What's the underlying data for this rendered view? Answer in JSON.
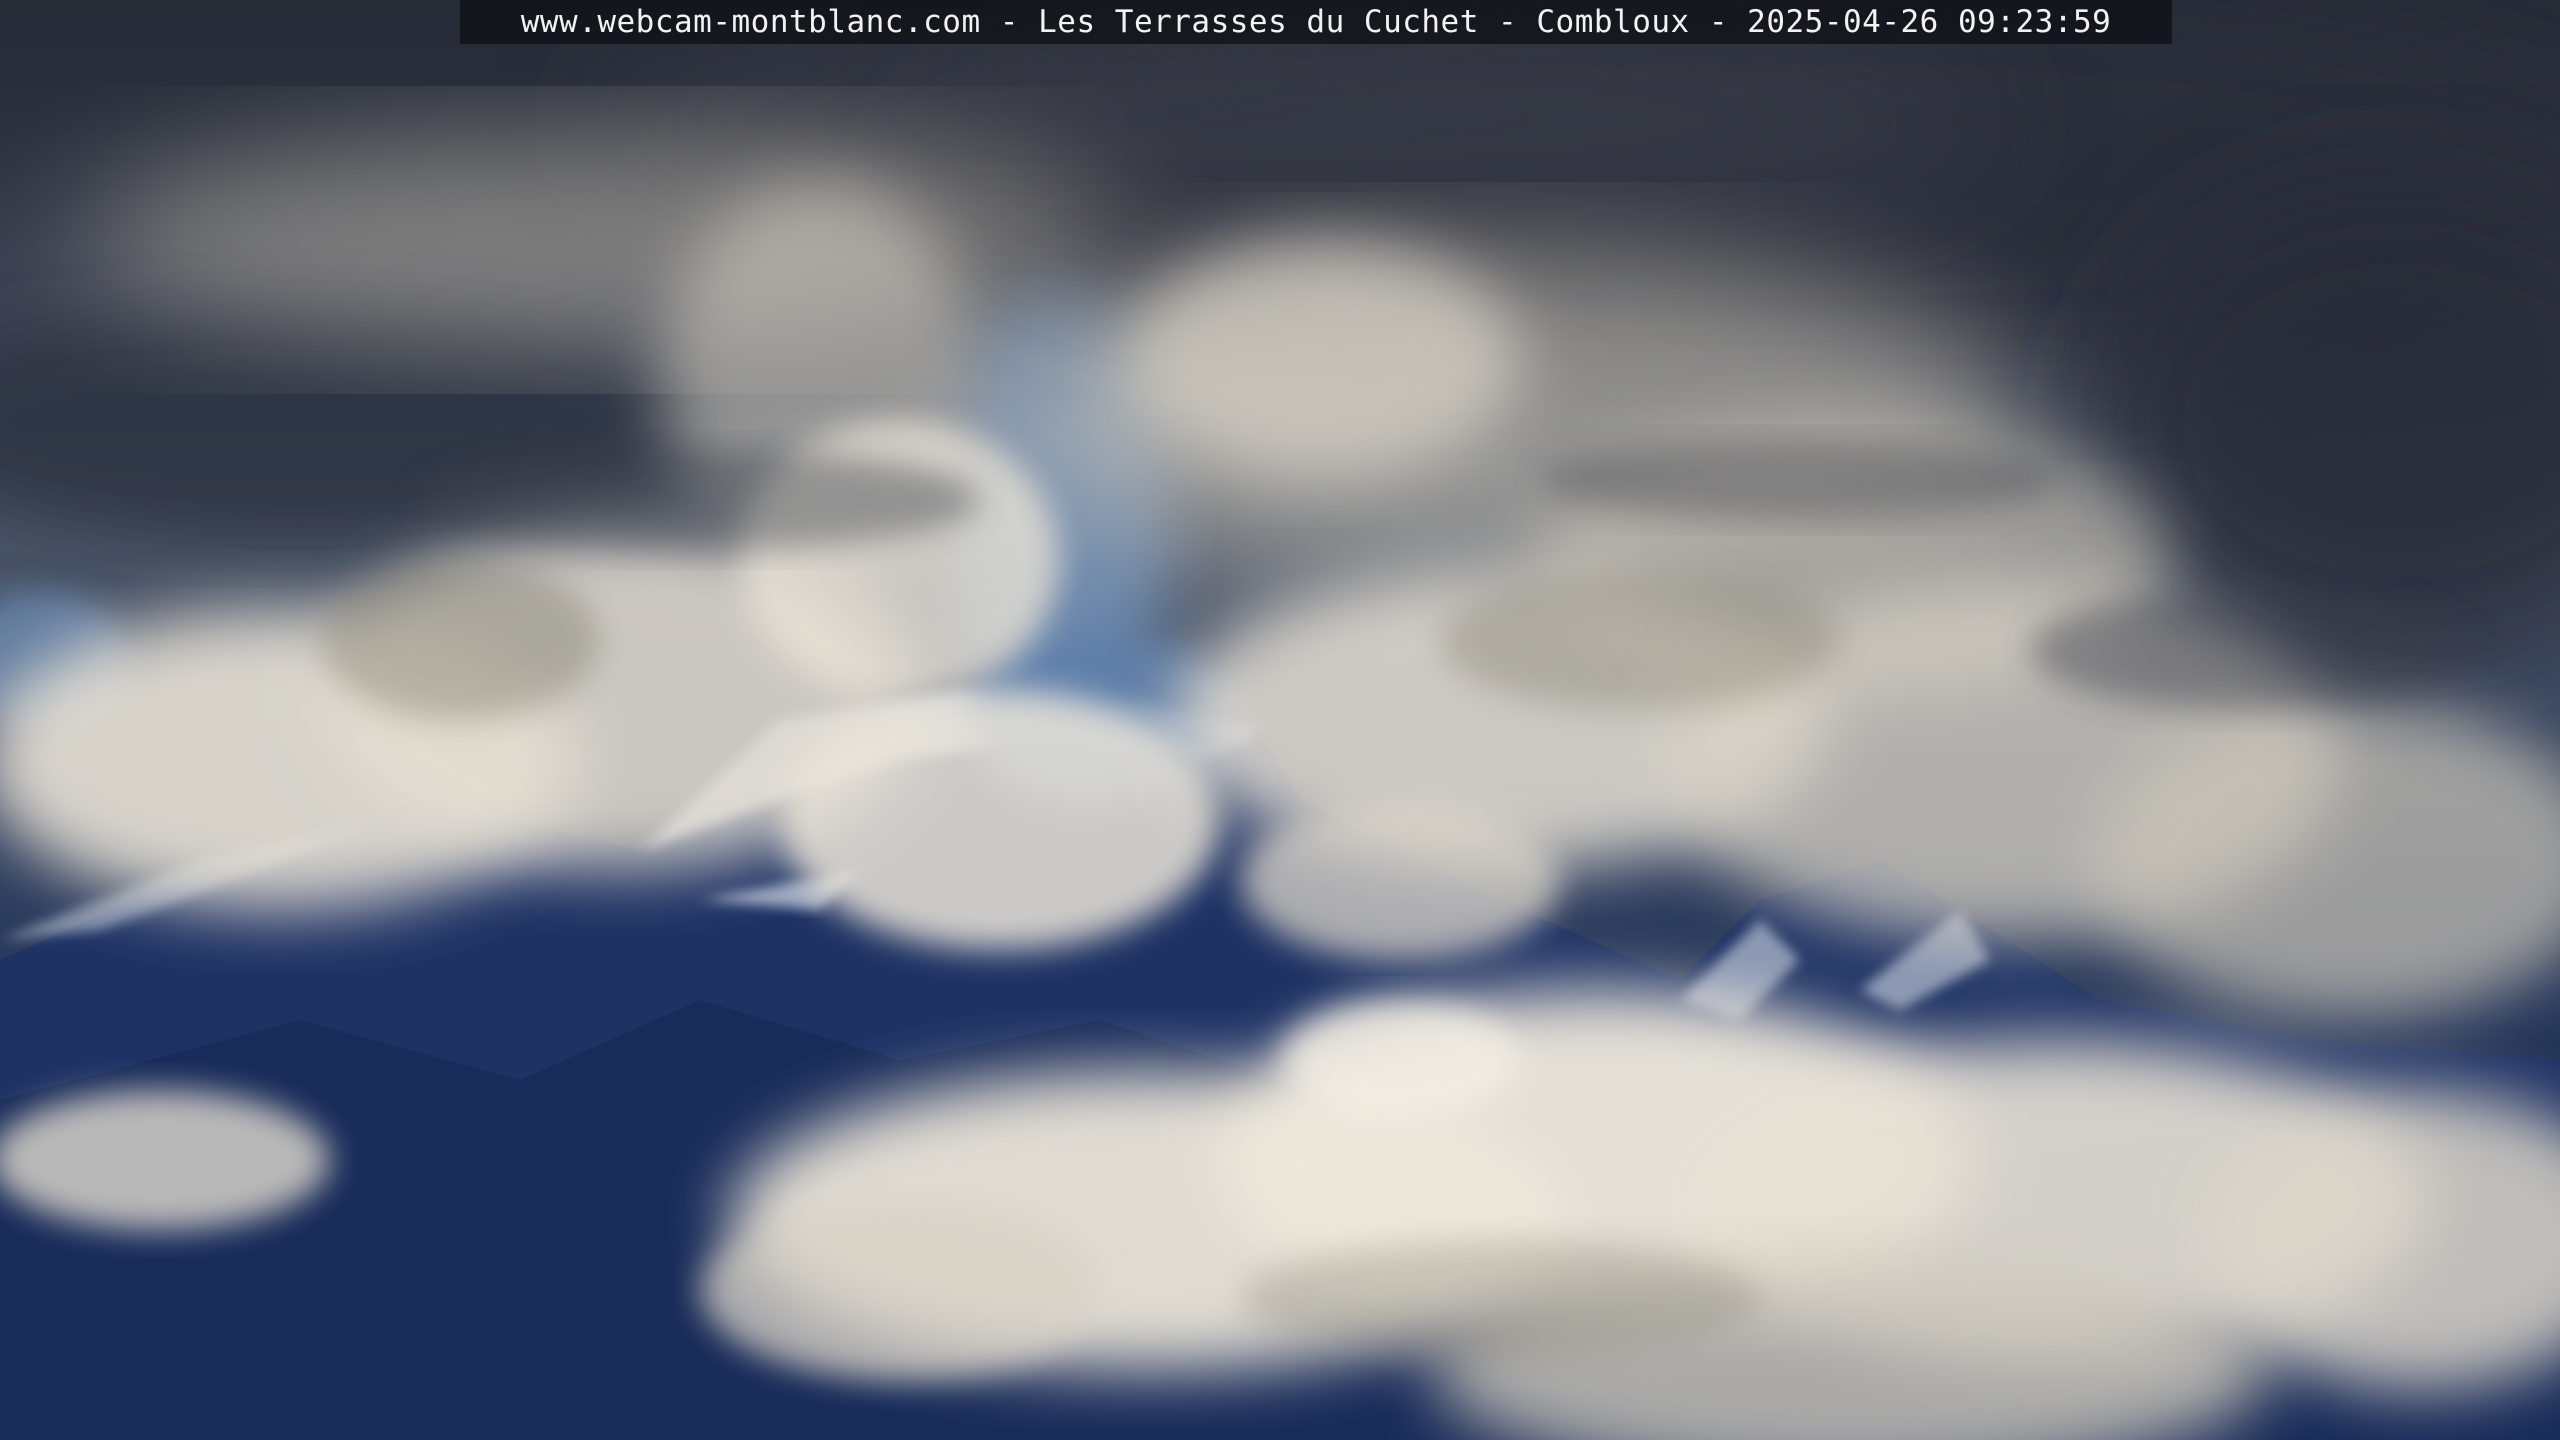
{
  "overlay": {
    "caption": "www.webcam-montblanc.com - Les Terrasses du Cuchet - Combloux - 2025-04-26 09:23:59"
  },
  "scene": {
    "subject": "clouds-over-snowy-mountain",
    "colors": {
      "dark_cloud": "#2a2f3b",
      "sky_blue": "#6e8fb8",
      "mountain_blue": "#1e3264",
      "cloud_light": "#e8e2d6",
      "cloud_shadow": "#8a8678",
      "snow": "#d8e0ec"
    }
  }
}
